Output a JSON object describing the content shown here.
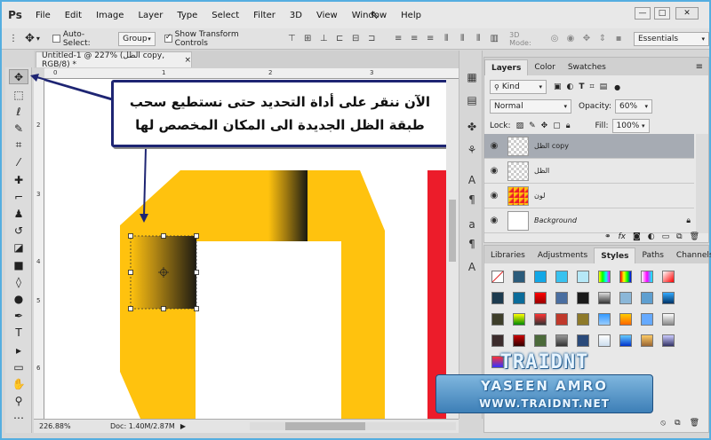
{
  "app": {
    "logo": "Ps"
  },
  "menu": [
    "File",
    "Edit",
    "Image",
    "Layer",
    "Type",
    "Select",
    "Filter",
    "3D",
    "View",
    "Window",
    "Help"
  ],
  "window_controls": [
    "—",
    "□",
    "✕"
  ],
  "options_bar": {
    "auto_select_label": "Auto-Select:",
    "group_value": "Group",
    "transform_label": "Show Transform Controls",
    "mode_label": "3D Mode:",
    "workspace": "Essentials"
  },
  "document": {
    "tab_title": "Untitled-1 @ 227% (الظل copy, RGB/8) *",
    "close": "×",
    "ruler_h": [
      "0",
      "1",
      "2",
      "3"
    ],
    "ruler_v": [
      "2",
      "3",
      "4",
      "5",
      "6"
    ]
  },
  "status": {
    "zoom": "226.88%",
    "doc": "Doc: 1.40M/2.87M"
  },
  "callout": {
    "line1": "الآن ننقر على أداة التحديد حتى نستطيع سحب",
    "line2": "طبقة الظل الجديدة الى المكان المخصص لها"
  },
  "layers_panel": {
    "tabs": [
      "Layers",
      "Color",
      "Swatches"
    ],
    "filter_kind": "Kind",
    "blend_mode": "Normal",
    "opacity_label": "Opacity:",
    "opacity_value": "60%",
    "lock_label": "Lock:",
    "fill_label": "Fill:",
    "fill_value": "100%",
    "layers": [
      {
        "name": "الظل copy",
        "selected": true
      },
      {
        "name": "الظل",
        "selected": false
      },
      {
        "name": "لون",
        "selected": false
      },
      {
        "name": "Background",
        "selected": false
      }
    ]
  },
  "styles_panel": {
    "tabs": [
      "Libraries",
      "Adjustments",
      "Styles",
      "Paths",
      "Channels"
    ]
  },
  "watermark": {
    "brand": "TRAIDNT",
    "name": "YASEEN AMRO",
    "url": "WWW.TRAIDNT.NET"
  },
  "colors": {
    "shape_yellow": "#ffc20e",
    "callout_border": "#1e2573",
    "red_strip": "#ec1c2a",
    "frame_blue": "#55aee0"
  }
}
